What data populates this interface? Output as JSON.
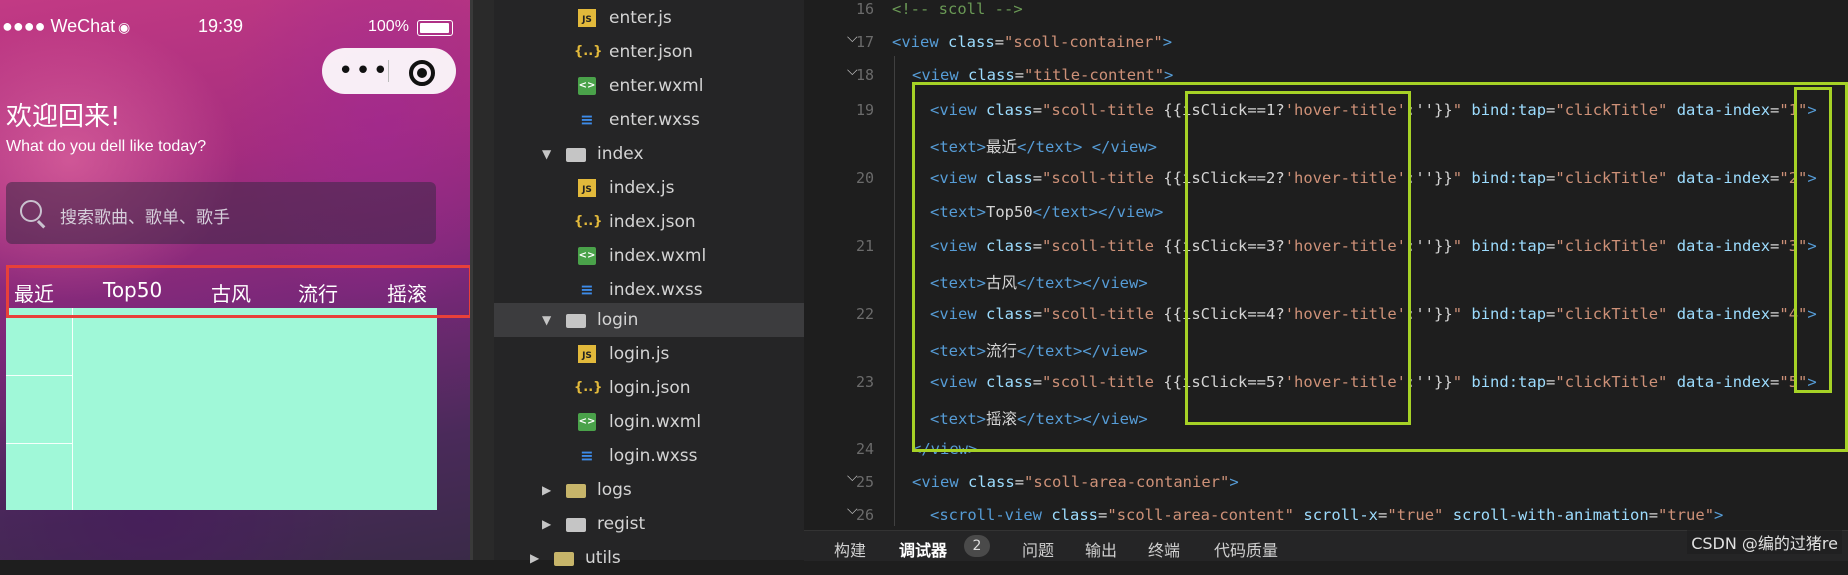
{
  "phone": {
    "carrier": "●●●● WeChat",
    "wifi_icon": "wifi-icon",
    "time": "19:39",
    "battery": "100%",
    "welcome": "欢迎回来!",
    "subtitle": "What do you dell like today?",
    "search_placeholder": "搜索歌曲、歌单、歌手",
    "tabs": [
      "最近",
      "Top50",
      "古风",
      "流行",
      "摇滚"
    ],
    "highlight_color": "#e8403a",
    "panel_color": "#a0f8d8"
  },
  "tree": {
    "rows": [
      {
        "label": "enter.js",
        "type": "js"
      },
      {
        "label": "enter.json",
        "type": "json"
      },
      {
        "label": "enter.wxml",
        "type": "wxml"
      },
      {
        "label": "enter.wxss",
        "type": "wxss"
      },
      {
        "label": "index",
        "type": "folder"
      },
      {
        "label": "index.js",
        "type": "js"
      },
      {
        "label": "index.json",
        "type": "json"
      },
      {
        "label": "index.wxml",
        "type": "wxml"
      },
      {
        "label": "index.wxss",
        "type": "wxss"
      },
      {
        "label": "login",
        "type": "folder"
      },
      {
        "label": "login.js",
        "type": "js"
      },
      {
        "label": "login.json",
        "type": "json"
      },
      {
        "label": "login.wxml",
        "type": "wxml"
      },
      {
        "label": "login.wxss",
        "type": "wxss"
      },
      {
        "label": "logs",
        "type": "folder"
      },
      {
        "label": "regist",
        "type": "folder"
      },
      {
        "label": "utils",
        "type": "folder"
      }
    ]
  },
  "editor": {
    "line_numbers": [
      "16",
      "17",
      "18",
      "19",
      "20",
      "21",
      "22",
      "23",
      "24",
      "25",
      "26"
    ],
    "comment": "<!-- scoll -->",
    "container_class": "scoll-container",
    "title_content_class": "title-content",
    "title_class": "scoll-title ",
    "hover_class": "hover-title",
    "tap_handler": "clickTitle",
    "items": [
      {
        "index": "1",
        "text": "最近"
      },
      {
        "index": "2",
        "text": "Top50"
      },
      {
        "index": "3",
        "text": "古风"
      },
      {
        "index": "4",
        "text": "流行"
      },
      {
        "index": "5",
        "text": "摇滚"
      }
    ],
    "area_class": "scoll-area-contanier",
    "scroll_class": "scoll-area-content",
    "scroll_x": "true",
    "scroll_anim": "true",
    "highlight_color": "#a6d226"
  },
  "bottom_tabs": [
    "构建",
    "调试器",
    "问题",
    "输出",
    "终端",
    "代码质量"
  ],
  "debugger_badge": "2",
  "watermark": "CSDN @编的过猪re"
}
